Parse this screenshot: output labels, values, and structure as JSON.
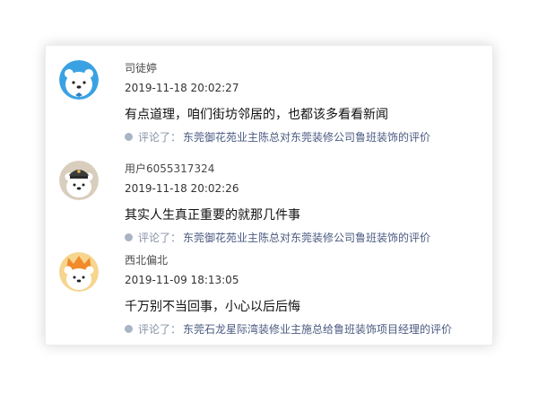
{
  "comments": [
    {
      "avatar": "bear-avatar-blue",
      "username": "司徒婷",
      "time": "2019-11-18 20:02:27",
      "content": "有点道理，咱们街坊邻居的，也都该多看看新闻",
      "ref_prefix": "评论了：",
      "ref_target": "东莞御花苑业主陈总对东莞装修公司鲁班装饰的评价"
    },
    {
      "avatar": "bear-avatar-captain",
      "username": "用户6055317324",
      "time": "2019-11-18 20:02:26",
      "content": "其实人生真正重要的就那几件事",
      "ref_prefix": "评论了：",
      "ref_target": "东莞御花苑业主陈总对东莞装修公司鲁班装饰的评价"
    },
    {
      "avatar": "bear-avatar-king",
      "username": "西北偏北",
      "time": "2019-11-09 18:13:05",
      "content": "千万别不当回事，小心以后后悔",
      "ref_prefix": "评论了：",
      "ref_target": "东莞石龙星际湾装修业主施总给鲁班装饰项目经理的评价"
    }
  ],
  "colors": {
    "avatar_blue": "#3aa2e3",
    "avatar_beige": "#d9cdbd",
    "avatar_yellow": "#f6d58e",
    "ref_dot": "#a9b4c4",
    "ref_link": "#4a5a80"
  }
}
